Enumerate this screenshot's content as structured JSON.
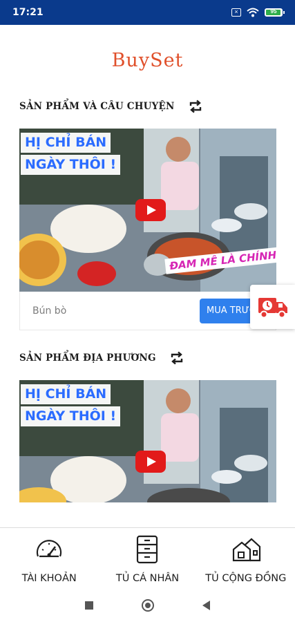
{
  "status_bar": {
    "time": "17:21",
    "battery": "95",
    "battery_level": 0.95
  },
  "app": {
    "logo": "BuySet"
  },
  "sections": [
    {
      "title": "SẢN PHẨM VÀ CÂU CHUYỆN",
      "video": {
        "headline_1": "HỊ CHỈ BÁN",
        "headline_2": "NGÀY THÔI !",
        "caption": "ĐAM MÊ LÀ CHÍNH"
      },
      "product_name": "Bún bò",
      "buy_label": "MUA TRƯỚC"
    },
    {
      "title": "SẢN PHẨM ĐỊA PHƯƠNG",
      "video": {
        "headline_1": "HỊ CHỈ BÁN",
        "headline_2": "NGÀY THÔI !"
      }
    }
  ],
  "bottom_nav": [
    {
      "label": "TÀI KHOẢN",
      "icon": "speedometer-icon"
    },
    {
      "label": "TỦ CÁ NHÂN",
      "icon": "cabinet-icon"
    },
    {
      "label": "TỦ CỘNG ĐỒNG",
      "icon": "community-houses-icon"
    }
  ],
  "colors": {
    "status_bar": "#0a3a8c",
    "logo": "#e0502b",
    "buy_button": "#2f80ed",
    "truck": "#e53935"
  }
}
